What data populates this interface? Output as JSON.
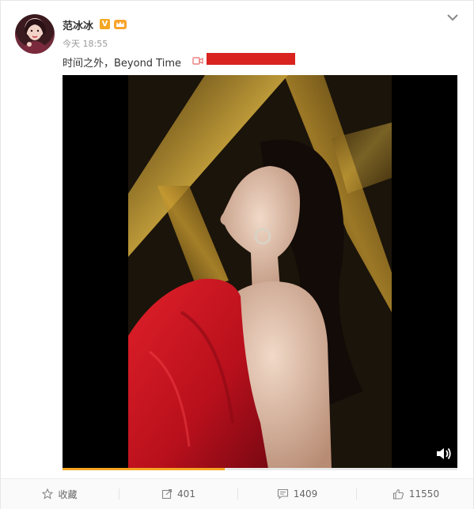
{
  "post": {
    "author": "范冰冰",
    "verified_badge": "V",
    "time": "今天 18:55",
    "text": "时间之外，Beyond Time",
    "redaction_color": "#d8231f"
  },
  "video": {
    "progress_fraction": 0.41,
    "progress_color": "#f5a623",
    "volume_icon": "volume-icon"
  },
  "actions": {
    "favorite_label": "收藏",
    "repost_count": "401",
    "comment_count": "1409",
    "like_count": "11550"
  }
}
